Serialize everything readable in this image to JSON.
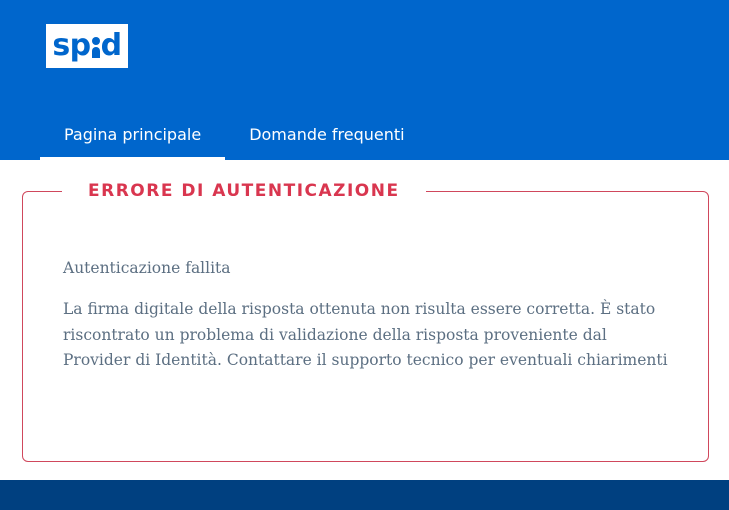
{
  "header": {
    "logo_text": "spid",
    "logo_s": "sp",
    "logo_d": "d",
    "bg_color": "#0066cc"
  },
  "nav": {
    "tabs": [
      {
        "label": "Pagina principale",
        "active": true
      },
      {
        "label": "Domande frequenti",
        "active": false
      }
    ]
  },
  "error": {
    "title": "ERRORE DI AUTENTICAZIONE",
    "subtitle": "Autenticazione fallita",
    "message": "La firma digitale della risposta ottenuta non risulta essere corretta. È stato riscontrato un problema di validazione della risposta proveniente dal Provider di Identità. Contattare il supporto tecnico per eventuali chiarimenti",
    "accent_color": "#d9364f"
  },
  "footer": {
    "bg_color": "#004080"
  }
}
